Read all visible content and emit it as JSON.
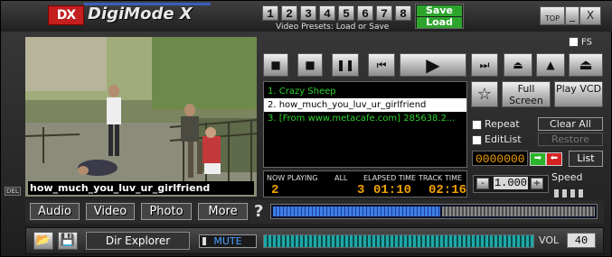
{
  "app": {
    "logo": "DX",
    "title": "DigiMode X"
  },
  "presets": {
    "numbers": [
      "1",
      "2",
      "3",
      "4",
      "5",
      "6",
      "7",
      "8"
    ],
    "label": "Video Presets: Load or Save",
    "save": "Save",
    "load": "Load"
  },
  "window": {
    "top": "TOP",
    "minimize": "_",
    "close": "X"
  },
  "video": {
    "caption": "how_much_you_luv_ur_girlfriend",
    "del": "DEL"
  },
  "transport": {
    "fs_label": "FS"
  },
  "playlist": {
    "items": [
      {
        "text": "1.  Crazy Sheep",
        "selected": false
      },
      {
        "text": "2.  how_much_you_luv_ur_girlfriend",
        "selected": true
      },
      {
        "text": "3.  [From www.metacafe.com] 285638.2...",
        "selected": false
      }
    ]
  },
  "now_playing": {
    "label_np": "NOW PLAYING",
    "label_all": "ALL",
    "label_elapsed": "ELAPSED TIME",
    "label_track": "TRACK TIME",
    "current": "2",
    "total": "3",
    "elapsed": "01:10",
    "track": "02:16"
  },
  "panel": {
    "full_screen": "Full Screen",
    "play_vcd": "Play VCD",
    "repeat": "Repeat",
    "clear_all": "Clear All",
    "editlist": "EditList",
    "restore": "Restore",
    "counter": "0000000",
    "list": "List",
    "speed_label": "Speed",
    "speed_value": "1.000",
    "speed_minus": "-",
    "speed_plus": "+"
  },
  "modes": {
    "audio": "Audio",
    "video": "Video",
    "photo": "Photo",
    "more": "More",
    "help": "?",
    "seek_fraction": 0.52
  },
  "bottom": {
    "dir_explorer": "Dir Explorer",
    "mute": "MUTE",
    "vol_label": "VOL",
    "vol_value": "40"
  }
}
